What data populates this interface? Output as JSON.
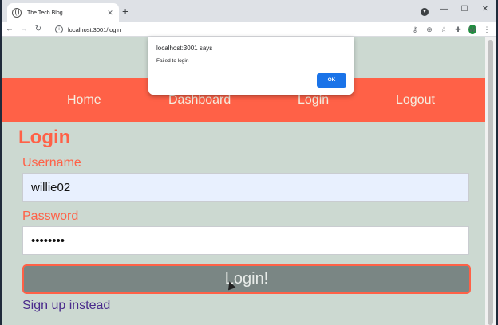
{
  "browser": {
    "tab_title": "The Tech Blog",
    "tab_close": "✕",
    "new_tab": "+",
    "url": "localhost:3001/login",
    "profile_initial": "W",
    "window_controls": [
      "—",
      "☐",
      "✕"
    ]
  },
  "nav": {
    "links": [
      "Home",
      "Dashboard",
      "Login",
      "Logout"
    ]
  },
  "form": {
    "heading": "Login",
    "username_label": "Username",
    "username_value": "willie02",
    "password_label": "Password",
    "password_value": "••••••••",
    "submit_label": "Login!",
    "signup_link": "Sign up instead"
  },
  "dialog": {
    "origin": "localhost:3001 says",
    "message": "Failed to login",
    "ok_label": "OK"
  },
  "colors": {
    "accent": "#ff6147",
    "page_background": "#ccd9d1",
    "button_fill": "#7a8684",
    "link": "#4a2b8c",
    "dialog_button": "#1a73e8"
  },
  "icons": [
    "globe-icon",
    "close-icon",
    "plus-icon",
    "back-icon",
    "forward-icon",
    "reload-icon",
    "info-icon",
    "key-icon",
    "zoom-icon",
    "star-icon",
    "extensions-icon",
    "menu-icon"
  ]
}
